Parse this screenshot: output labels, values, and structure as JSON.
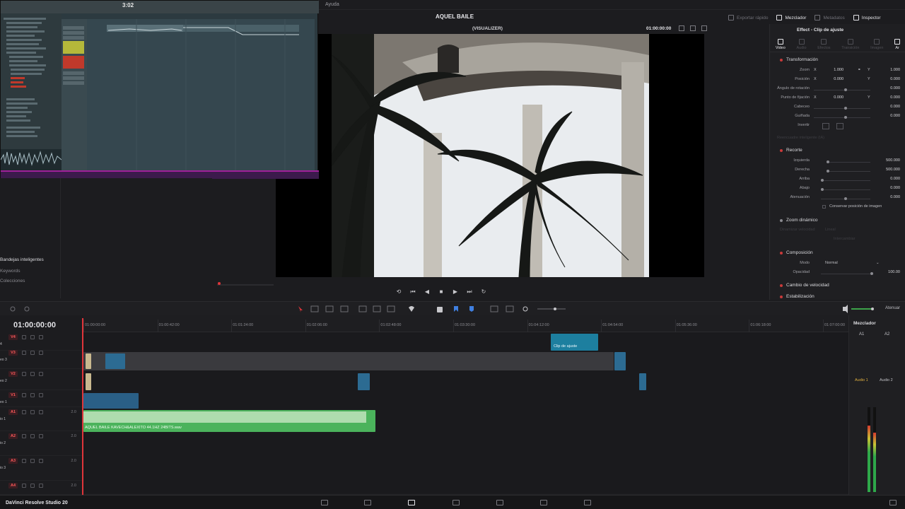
{
  "menu": {
    "ayuda": "Ayuda"
  },
  "header": {
    "project_title": "AQUEL BAILE",
    "tools": [
      "Exportar rápido",
      "Mezclador",
      "Metadatos",
      "Inspector"
    ]
  },
  "viewer": {
    "mode": "(VISUALIZER)",
    "timecode": "01:00:00:00"
  },
  "fl": {
    "clock": "3:02"
  },
  "pool": {
    "items": [
      "Bandejas inteligentes",
      "Keywords",
      "Colecciones"
    ]
  },
  "inspector": {
    "title": "Effect - Clip de ajuste",
    "tabs": [
      "Video",
      "Audio",
      "Efectos",
      "Transición",
      "Imagen",
      "Ar"
    ],
    "sections": {
      "transform": "Transformación",
      "crop": "Recorte",
      "dynzoom": "Zoom dinámico",
      "composite": "Composición",
      "speed": "Cambio de velocidad",
      "stab": "Estabilización",
      "smart": "Reencuadre inteligente (IA)"
    },
    "transform_rows": [
      {
        "label": "Zoom",
        "x": "1.000",
        "y": "1.000"
      },
      {
        "label": "Posición",
        "x": "0.000",
        "y": "0.000"
      },
      {
        "label": "Ángulo de rotación",
        "v": "0.000"
      },
      {
        "label": "Punto de fijación",
        "x": "0.000",
        "y": "0.000"
      },
      {
        "label": "Cabeceo",
        "v": "0.000"
      },
      {
        "label": "Guiñada",
        "v": "0.000"
      }
    ],
    "invert": "Invertir",
    "crop_rows": [
      {
        "label": "Izquierda",
        "v": "500.000"
      },
      {
        "label": "Derecha",
        "v": "500.000"
      },
      {
        "label": "Arriba",
        "v": "0.000"
      },
      {
        "label": "Abajo",
        "v": "0.000"
      },
      {
        "label": "Atenuación",
        "v": "0.000"
      }
    ],
    "keep_pos": "Conservar posición de imagen",
    "dynzoom_ease": "Dinamizar velocidad",
    "dynzoom_lin": "Lineal",
    "dynzoom_swap": "Intercambiar",
    "comp_mode_label": "Modo",
    "comp_mode": "Normal",
    "opacity_label": "Opacidad",
    "opacity": "100.00"
  },
  "timeline": {
    "timecode": "01:00:00:00",
    "ticks": [
      "01:00:00:00",
      "01:00:42:00",
      "01:01:24:00",
      "01:02:06:00",
      "01:02:48:00",
      "01:03:30:00",
      "01:04:12:00",
      "01:04:54:00",
      "01:05:36:00",
      "01:06:18:00",
      "01:07:00:00"
    ],
    "atenuar": "Atenuar",
    "tracks": [
      {
        "badge": "V4",
        "name": "4"
      },
      {
        "badge": "V3",
        "name": "eo 3"
      },
      {
        "badge": "V2",
        "name": "eo 2"
      },
      {
        "badge": "V1",
        "name": "eo 1"
      },
      {
        "badge": "A1",
        "name": "io 1",
        "val": "2.0"
      },
      {
        "badge": "A2",
        "name": "io 2",
        "val": "2.0"
      },
      {
        "badge": "A3",
        "name": "io 3",
        "val": "2.0"
      },
      {
        "badge": "A4",
        "name": "",
        "val": "2.0"
      }
    ],
    "adjust_clip": "Clip de ajuste",
    "audio_clip": "AQUEL BAILE KAVECH&ALEXITO 44.1HZ 24BITS.wav"
  },
  "mixer": {
    "title": "Mezclador",
    "channels": [
      "A1",
      "A2"
    ],
    "audio_labels": [
      "Audio 1",
      "Audio 2"
    ],
    "levels": [
      0.78,
      0.7
    ]
  },
  "footer": {
    "app_name": "DaVinci Resolve Studio 20"
  }
}
